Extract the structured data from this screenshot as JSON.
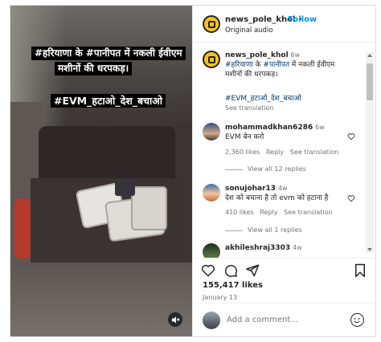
{
  "video": {
    "caption_line1": "#हरियाणा के #पानीपत में नकली ईवीएम",
    "caption_line2": "मशीनों की धरपकड़।",
    "caption_hashtag": "#EVM_हटाओ_देश_बचाओ",
    "mute_icon": "speaker-muted-icon"
  },
  "header": {
    "username": "news_pole_khol",
    "separator": "•",
    "follow_label": "Follow",
    "audio": "Original audio"
  },
  "post": {
    "username": "news_pole_khol",
    "age": "6w",
    "caption_line1_hash1": "#हरियाणा",
    "caption_line1_mid": "के",
    "caption_line1_hash2": "#पानीपत",
    "caption_line1_rest": "में नकली ईवीएम",
    "caption_line2": "मशीनों की धरपकड़।",
    "caption_hashtag": "#EVM_हटाओ_देश_बचाओ",
    "see_translation": "See translation"
  },
  "comments": [
    {
      "username": "mohammadkhan6286",
      "age": "6w",
      "text": "EVM बेन करो",
      "likes": "2,360 likes",
      "reply": "Reply",
      "translation": "See translation",
      "view_replies": "View all 12 replies"
    },
    {
      "username": "sonujohar13",
      "age": "4w",
      "text": "देश को बचाना है तो evm को हटाना है",
      "likes": "410 likes",
      "reply": "Reply",
      "translation": "See translation",
      "view_replies": "View all 1 replies"
    },
    {
      "username": "akhileshraj3303",
      "age": "4w"
    }
  ],
  "actions": {
    "likes": "155,417 likes",
    "date": "January 13"
  },
  "add_comment": {
    "placeholder": "Add a comment..."
  },
  "colors": {
    "link_blue": "#0095f6",
    "hashtag_blue": "#00376b",
    "caption_bg": "#000000"
  }
}
